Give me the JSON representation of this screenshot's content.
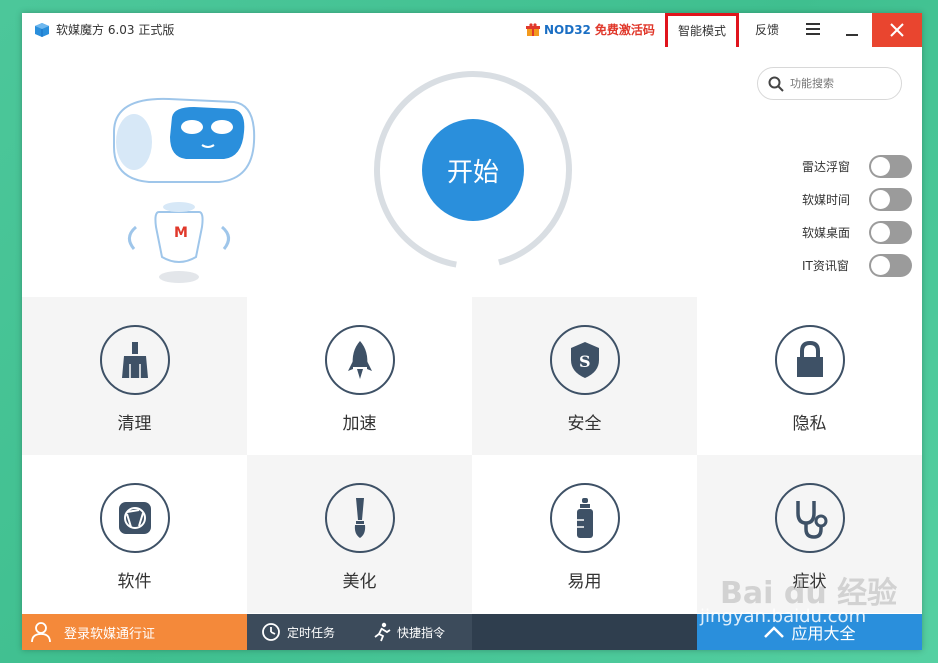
{
  "titlebar": {
    "app_title": "软媒魔方 6.03 正式版",
    "promo_product": "NOD32",
    "promo_text": "免费激活码",
    "mode_button": "智能模式",
    "feedback": "反馈"
  },
  "hero": {
    "start_label": "开始",
    "search_placeholder": "功能搜索",
    "toggles": [
      {
        "label": "雷达浮窗",
        "on": false
      },
      {
        "label": "软媒时间",
        "on": false
      },
      {
        "label": "软媒桌面",
        "on": false
      },
      {
        "label": "IT资讯窗",
        "on": false
      }
    ]
  },
  "tiles": [
    {
      "label": "清理",
      "icon": "broom-icon"
    },
    {
      "label": "加速",
      "icon": "rocket-icon"
    },
    {
      "label": "安全",
      "icon": "shield-icon"
    },
    {
      "label": "隐私",
      "icon": "lock-icon"
    },
    {
      "label": "软件",
      "icon": "aperture-icon"
    },
    {
      "label": "美化",
      "icon": "brush-icon"
    },
    {
      "label": "易用",
      "icon": "bottle-icon"
    },
    {
      "label": "症状",
      "icon": "stethoscope-icon"
    }
  ],
  "bottombar": {
    "login": "登录软媒通行证",
    "scheduled": "定时任务",
    "shortcut": "快捷指令",
    "apps": "应用大全"
  },
  "watermark": {
    "brand": "Bai du 经验",
    "url": "jingyan.baidu.com"
  },
  "colors": {
    "accent_blue": "#2a8fdc",
    "orange": "#f4893a",
    "close_red": "#e9452f",
    "highlight_red": "#e0141c",
    "dark_bar": "#2f3e4e"
  }
}
